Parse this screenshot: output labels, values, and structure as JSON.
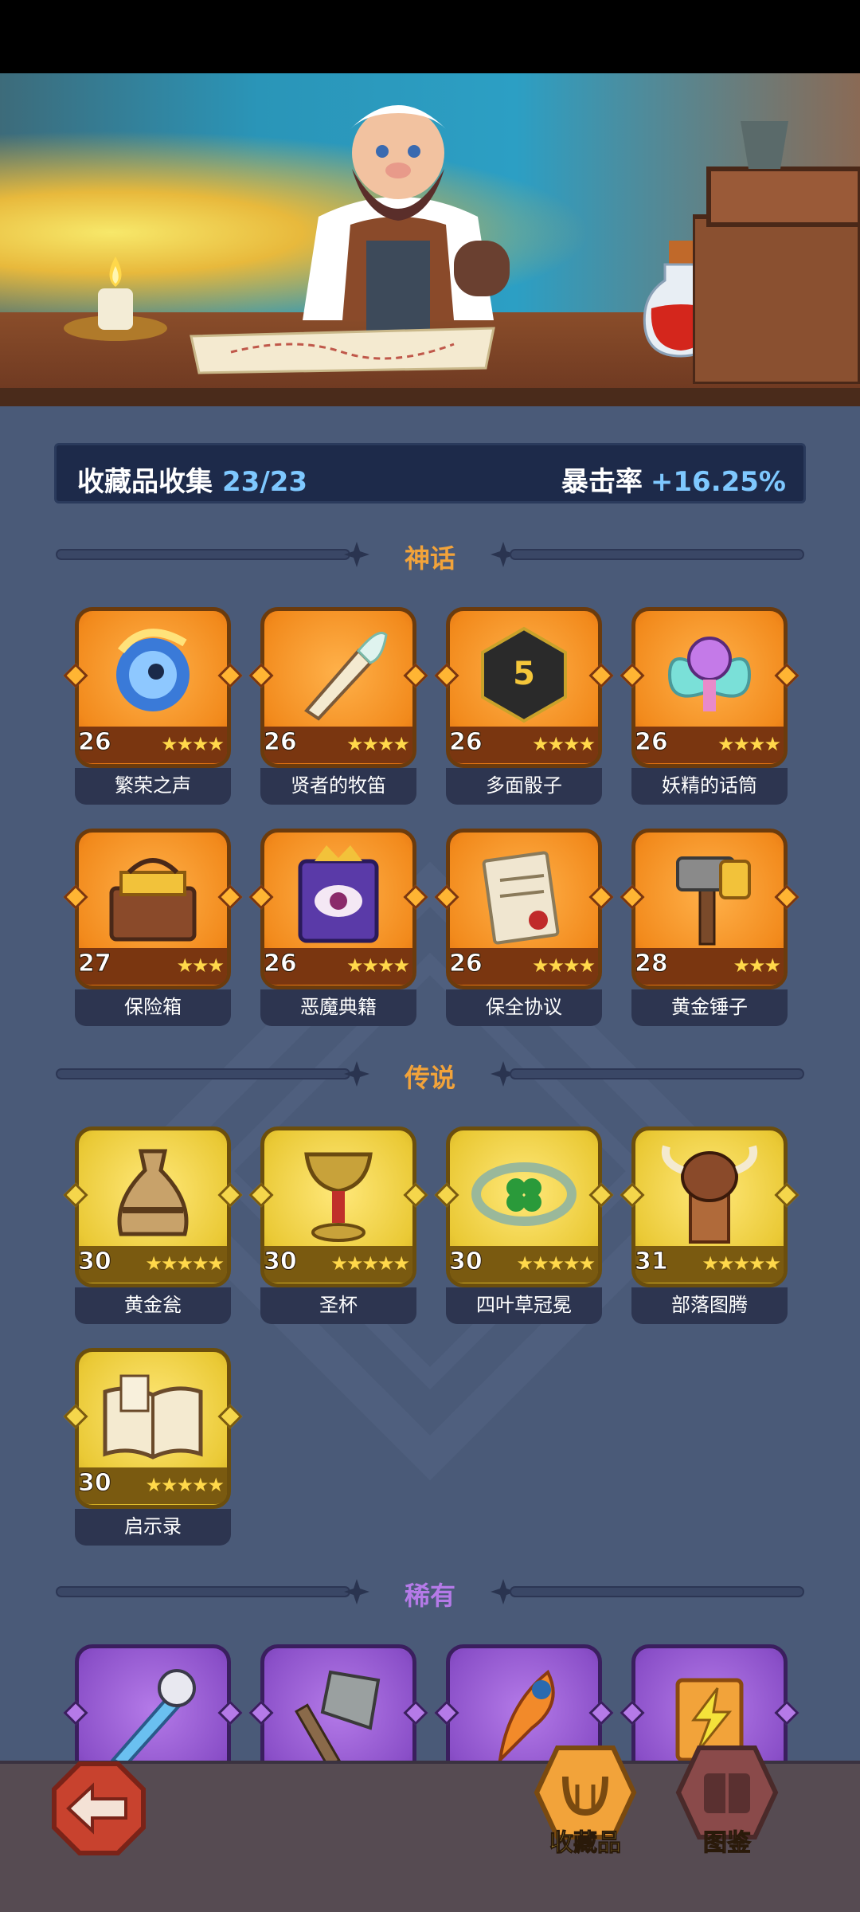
{
  "header": {
    "collection_label": "收藏品收集",
    "collection_count": "23/23",
    "crit_label": "暴击率",
    "crit_value": "+16.25%"
  },
  "sections": {
    "mythic": {
      "title": "神话",
      "color": "#f2a33a"
    },
    "legendary": {
      "title": "传说",
      "color": "#f2a33a"
    },
    "rare": {
      "title": "稀有",
      "color": "#b57ae8"
    }
  },
  "mythic_items": [
    {
      "name": "繁荣之声",
      "level": "26",
      "stars": "★★★★",
      "icon": "blue-swirl-charm-icon"
    },
    {
      "name": "贤者的牧笛",
      "level": "26",
      "stars": "★★★★",
      "icon": "feather-pipe-icon"
    },
    {
      "name": "多面骰子",
      "level": "26",
      "stars": "★★★★",
      "icon": "d20-dice-icon"
    },
    {
      "name": "妖精的话筒",
      "level": "26",
      "stars": "★★★★",
      "icon": "fairy-microphone-icon"
    },
    {
      "name": "保险箱",
      "level": "27",
      "stars": "★★★",
      "icon": "treasure-chest-icon"
    },
    {
      "name": "恶魔典籍",
      "level": "26",
      "stars": "★★★★",
      "icon": "demon-tome-icon"
    },
    {
      "name": "保全协议",
      "level": "26",
      "stars": "★★★★",
      "icon": "scroll-contract-icon"
    },
    {
      "name": "黄金锤子",
      "level": "28",
      "stars": "★★★",
      "icon": "golden-hammer-icon"
    }
  ],
  "legendary_items": [
    {
      "name": "黄金瓮",
      "level": "30",
      "stars": "★★★★★",
      "icon": "golden-urn-icon"
    },
    {
      "name": "圣杯",
      "level": "30",
      "stars": "★★★★★",
      "icon": "holy-grail-icon"
    },
    {
      "name": "四叶草冠冕",
      "level": "30",
      "stars": "★★★★★",
      "icon": "clover-crown-icon"
    },
    {
      "name": "部落图腾",
      "level": "31",
      "stars": "★★★★★",
      "icon": "tribal-totem-icon"
    },
    {
      "name": "启示录",
      "level": "30",
      "stars": "★★★★★",
      "icon": "open-book-icon"
    }
  ],
  "rare_items": [
    {
      "icon": "ice-sword-icon"
    },
    {
      "icon": "stone-axe-icon"
    },
    {
      "icon": "flame-feather-icon"
    },
    {
      "icon": "lightning-tome-icon"
    }
  ],
  "nav": {
    "collection_label": "收藏品",
    "codex_label": "图鉴"
  }
}
